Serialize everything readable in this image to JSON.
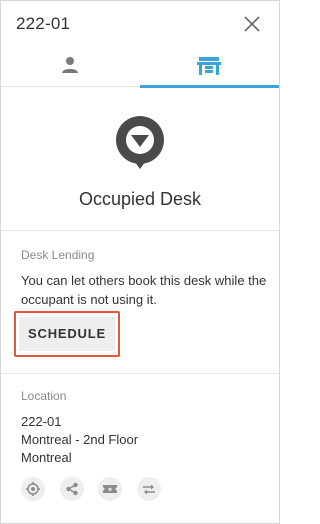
{
  "header": {
    "title": "222-01",
    "close_icon": "close-icon"
  },
  "tabs": [
    {
      "name": "person",
      "icon": "person-icon",
      "active": false
    },
    {
      "name": "desk",
      "icon": "desk-icon",
      "active": true
    }
  ],
  "status": {
    "icon": "occupied-pin-icon",
    "title": "Occupied Desk"
  },
  "desk_lending": {
    "label": "Desk Lending",
    "description": "You can let others book this desk while the occupant is not using it.",
    "schedule_label": "SCHEDULE"
  },
  "location": {
    "label": "Location",
    "desk": "222-01",
    "floor": "Montreal - 2nd Floor",
    "building": "Montreal"
  },
  "actions": [
    {
      "icon": "locate-icon"
    },
    {
      "icon": "share-icon"
    },
    {
      "icon": "ticket-icon"
    },
    {
      "icon": "swap-icon"
    }
  ],
  "colors": {
    "accent": "#3aa3dc",
    "highlight": "#e0573a",
    "button_bg": "#eeeeee",
    "status_icon": "#4a4a4a"
  }
}
